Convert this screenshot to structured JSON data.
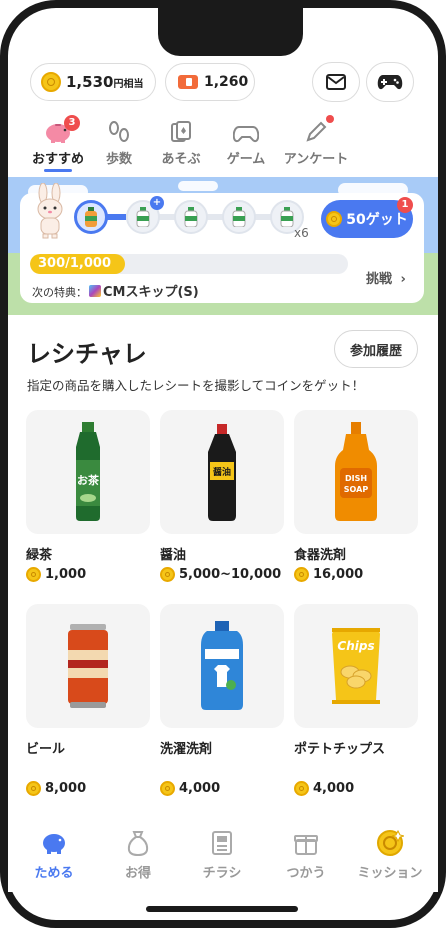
{
  "header": {
    "coin_value": "1,530",
    "coin_unit": "円相当",
    "ticket_value": "1,260"
  },
  "tabs": [
    {
      "label": "おすすめ",
      "icon": "piggy-bank-icon",
      "badge": "3",
      "active": true
    },
    {
      "label": "歩数",
      "icon": "footsteps-icon"
    },
    {
      "label": "あそぶ",
      "icon": "cards-icon"
    },
    {
      "label": "ゲーム",
      "icon": "gamepad-icon"
    },
    {
      "label": "アンケート",
      "icon": "pencil-icon",
      "dot": true
    }
  ],
  "mission": {
    "get_label": "50ゲット",
    "get_badge": "1",
    "repeat_label": "x6",
    "progress_text": "300/1,000",
    "progress_fraction": 0.3,
    "challenge_label": "挑戦",
    "next_perk_label": "次の特典：",
    "next_perk_value": "CMスキップ(S)"
  },
  "section": {
    "title": "レシチャレ",
    "history_button": "参加履歴",
    "description": "指定の商品を購入したレシートを撮影してコインをゲット！"
  },
  "products": [
    {
      "name": "緑茶",
      "price": "1,000",
      "image": "green-tea-bottle"
    },
    {
      "name": "醤油",
      "price": "5,000~10,000",
      "image": "soy-sauce-bottle"
    },
    {
      "name": "食器洗剤",
      "price": "16,000",
      "image": "dish-soap-bottle"
    },
    {
      "name": "ビール",
      "price": "8,000",
      "image": "beer-can"
    },
    {
      "name": "洗濯洗剤",
      "price": "4,000",
      "image": "laundry-detergent"
    },
    {
      "name": "ポテトチップス",
      "price": "4,000",
      "image": "potato-chips-bag"
    }
  ],
  "product_image_text": {
    "tea_label": "お茶",
    "soy_label": "醤油",
    "soap_label_1": "DISH",
    "soap_label_2": "SOAP",
    "chips_label": "Chips"
  },
  "bottom_nav": [
    {
      "label": "ためる",
      "icon": "piggy-bank-icon",
      "active": true
    },
    {
      "label": "お得",
      "icon": "money-bag-icon"
    },
    {
      "label": "チラシ",
      "icon": "flyer-icon"
    },
    {
      "label": "つかう",
      "icon": "gift-icon"
    },
    {
      "label": "ミッション",
      "icon": "mission-coin-icon"
    }
  ],
  "colors": {
    "accent": "#4a79f0",
    "coin": "#f5c518",
    "badge": "#ef4d4d"
  }
}
